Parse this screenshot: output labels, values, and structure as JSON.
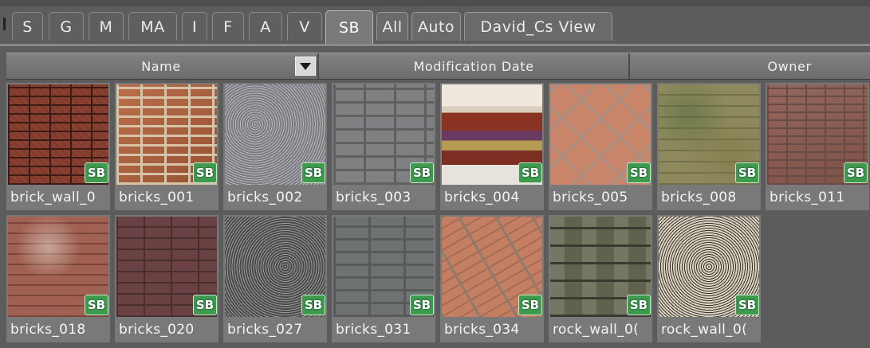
{
  "tabs": [
    {
      "label": "S"
    },
    {
      "label": "G"
    },
    {
      "label": "M"
    },
    {
      "label": "MA"
    },
    {
      "label": "I"
    },
    {
      "label": "F"
    },
    {
      "label": "A"
    },
    {
      "label": "V"
    },
    {
      "label": "SB",
      "active": true
    },
    {
      "label": "All"
    },
    {
      "label": "Auto"
    },
    {
      "label": "David_Cs View"
    }
  ],
  "columns": {
    "name": "Name",
    "modification_date": "Modification Date",
    "owner": "Owner"
  },
  "badge_label": "SB",
  "items": [
    {
      "name": "brick_wall_0",
      "texture": "dark red brick wall"
    },
    {
      "name": "bricks_001",
      "texture": "red bricks with light mortar"
    },
    {
      "name": "bricks_002",
      "texture": "grey gravel"
    },
    {
      "name": "bricks_003",
      "texture": "grey stone blocks"
    },
    {
      "name": "bricks_004",
      "texture": "decorative tile band"
    },
    {
      "name": "bricks_005",
      "texture": "herringbone brick"
    },
    {
      "name": "bricks_008",
      "texture": "mossy stone"
    },
    {
      "name": "bricks_011",
      "texture": "weathered brick"
    },
    {
      "name": "bricks_018",
      "texture": "worn red brick"
    },
    {
      "name": "bricks_020",
      "texture": "dark brick"
    },
    {
      "name": "bricks_027",
      "texture": "granite"
    },
    {
      "name": "bricks_031",
      "texture": "grey block wall"
    },
    {
      "name": "bricks_034",
      "texture": "diagonal brick"
    },
    {
      "name": "rock_wall_0(",
      "texture": "rock wall"
    },
    {
      "name": "rock_wall_0(",
      "texture": "speckled rock wall"
    }
  ]
}
